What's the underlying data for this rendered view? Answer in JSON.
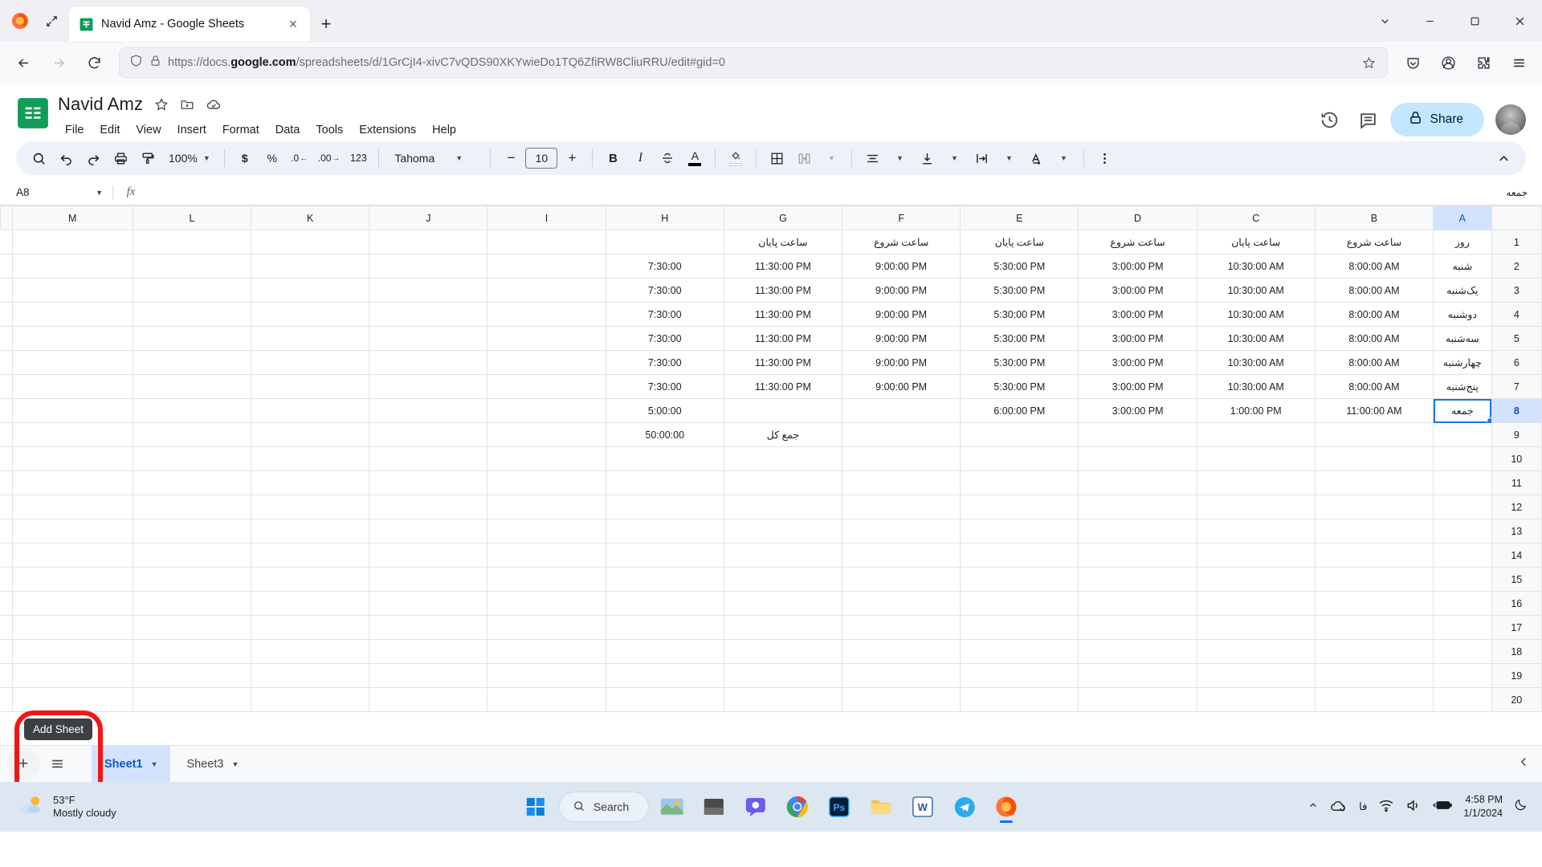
{
  "browser": {
    "tab": {
      "title": "Navid Amz - Google Sheets",
      "favicon": "sheets-icon"
    },
    "new_tab_label": "+",
    "close_label": "×",
    "url": "https://docs.google.com/spreadsheets/d/1GrCjI4-xivC7vQDS90XKYwieDo1TQ6ZfiRW8CliuRRU/edit#gid=0",
    "url_domain": "google.com",
    "url_prefix": "https://docs.",
    "url_suffix": "/spreadsheets/d/1GrCjI4-xivC7vQDS90XKYwieDo1TQ6ZfiRW8CliuRRU/edit#gid=0"
  },
  "sheets": {
    "doc_title": "Navid Amz",
    "menus": [
      "File",
      "Edit",
      "View",
      "Insert",
      "Format",
      "Data",
      "Tools",
      "Extensions",
      "Help"
    ],
    "share_label": "Share",
    "toolbar": {
      "zoom": "100%",
      "font": "Tahoma",
      "font_size": "10",
      "decrease_label": "−",
      "increase_label": "+",
      "bold": "B",
      "italic": "I",
      "strikethrough": "S",
      "text_color": "A",
      "currency": "$",
      "percent": "%",
      "decimal_decrease": ".0",
      "decimal_increase": ".00",
      "more_formats": "123"
    },
    "formula_bar": {
      "name_box": "A8",
      "fx_label": "fx",
      "value": "جمعه"
    },
    "grid": {
      "columns": [
        "M",
        "L",
        "K",
        "J",
        "I",
        "H",
        "G",
        "F",
        "E",
        "D",
        "C",
        "B",
        "A"
      ],
      "selected_column": "A",
      "selected_cell": "A8",
      "rows": [
        1,
        2,
        3,
        4,
        5,
        6,
        7,
        8,
        9,
        10,
        11,
        12,
        13,
        14,
        15,
        16,
        17,
        18,
        19,
        20
      ],
      "data": [
        [
          "",
          "",
          "",
          "",
          "",
          "",
          "ساعت پایان",
          "ساعت شروع",
          "ساعت پایان",
          "ساعت شروع",
          "ساعت پایان",
          "ساعت شروع",
          "روز"
        ],
        [
          "",
          "",
          "",
          "",
          "",
          "7:30:00",
          "11:30:00 PM",
          "9:00:00 PM",
          "5:30:00 PM",
          "3:00:00 PM",
          "10:30:00 AM",
          "8:00:00 AM",
          "شنبه"
        ],
        [
          "",
          "",
          "",
          "",
          "",
          "7:30:00",
          "11:30:00 PM",
          "9:00:00 PM",
          "5:30:00 PM",
          "3:00:00 PM",
          "10:30:00 AM",
          "8:00:00 AM",
          "یک‌شنبه"
        ],
        [
          "",
          "",
          "",
          "",
          "",
          "7:30:00",
          "11:30:00 PM",
          "9:00:00 PM",
          "5:30:00 PM",
          "3:00:00 PM",
          "10:30:00 AM",
          "8:00:00 AM",
          "دوشنبه"
        ],
        [
          "",
          "",
          "",
          "",
          "",
          "7:30:00",
          "11:30:00 PM",
          "9:00:00 PM",
          "5:30:00 PM",
          "3:00:00 PM",
          "10:30:00 AM",
          "8:00:00 AM",
          "سه‌شنبه"
        ],
        [
          "",
          "",
          "",
          "",
          "",
          "7:30:00",
          "11:30:00 PM",
          "9:00:00 PM",
          "5:30:00 PM",
          "3:00:00 PM",
          "10:30:00 AM",
          "8:00:00 AM",
          "چهارشنبه"
        ],
        [
          "",
          "",
          "",
          "",
          "",
          "7:30:00",
          "11:30:00 PM",
          "9:00:00 PM",
          "5:30:00 PM",
          "3:00:00 PM",
          "10:30:00 AM",
          "8:00:00 AM",
          "پنج‌شنبه"
        ],
        [
          "",
          "",
          "",
          "",
          "",
          "5:00:00",
          "",
          "",
          "6:00:00 PM",
          "3:00:00 PM",
          "1:00:00 PM",
          "11:00:00 AM",
          "جمعه"
        ],
        [
          "",
          "",
          "",
          "",
          "",
          "50:00:00",
          "جمع کل",
          "",
          "",
          "",
          "",
          "",
          ""
        ],
        [
          "",
          "",
          "",
          "",
          "",
          "",
          "",
          "",
          "",
          "",
          "",
          "",
          ""
        ],
        [
          "",
          "",
          "",
          "",
          "",
          "",
          "",
          "",
          "",
          "",
          "",
          "",
          ""
        ],
        [
          "",
          "",
          "",
          "",
          "",
          "",
          "",
          "",
          "",
          "",
          "",
          "",
          ""
        ],
        [
          "",
          "",
          "",
          "",
          "",
          "",
          "",
          "",
          "",
          "",
          "",
          "",
          ""
        ],
        [
          "",
          "",
          "",
          "",
          "",
          "",
          "",
          "",
          "",
          "",
          "",
          "",
          ""
        ],
        [
          "",
          "",
          "",
          "",
          "",
          "",
          "",
          "",
          "",
          "",
          "",
          "",
          ""
        ],
        [
          "",
          "",
          "",
          "",
          "",
          "",
          "",
          "",
          "",
          "",
          "",
          "",
          ""
        ],
        [
          "",
          "",
          "",
          "",
          "",
          "",
          "",
          "",
          "",
          "",
          "",
          "",
          ""
        ],
        [
          "",
          "",
          "",
          "",
          "",
          "",
          "",
          "",
          "",
          "",
          "",
          "",
          ""
        ],
        [
          "",
          "",
          "",
          "",
          "",
          "",
          "",
          "",
          "",
          "",
          "",
          "",
          ""
        ],
        [
          "",
          "",
          "",
          "",
          "",
          "",
          "",
          "",
          "",
          "",
          "",
          "",
          ""
        ]
      ]
    },
    "sheet_tabs": [
      {
        "label": "Sheet1",
        "active": true
      },
      {
        "label": "Sheet3",
        "active": false
      }
    ],
    "add_sheet_tooltip": "Add Sheet",
    "add_sheet_label": "+"
  },
  "taskbar": {
    "weather_temp": "53°F",
    "weather_desc": "Mostly cloudy",
    "search_placeholder": "Search",
    "apps": [
      "widgets-icon",
      "chat-icon",
      "chrome-icon",
      "photoshop-icon",
      "file-explorer-icon",
      "word-icon",
      "telegram-icon",
      "firefox-icon"
    ],
    "language": "فا",
    "time": "4:58 PM",
    "date": "1/1/2024"
  },
  "colors": {
    "sheets_green": "#0f9d58",
    "accent_blue": "#1a73e8",
    "share_bg": "#c2e7ff",
    "annotation_red": "#f51414",
    "toolbar_bg": "#edf2fa"
  }
}
